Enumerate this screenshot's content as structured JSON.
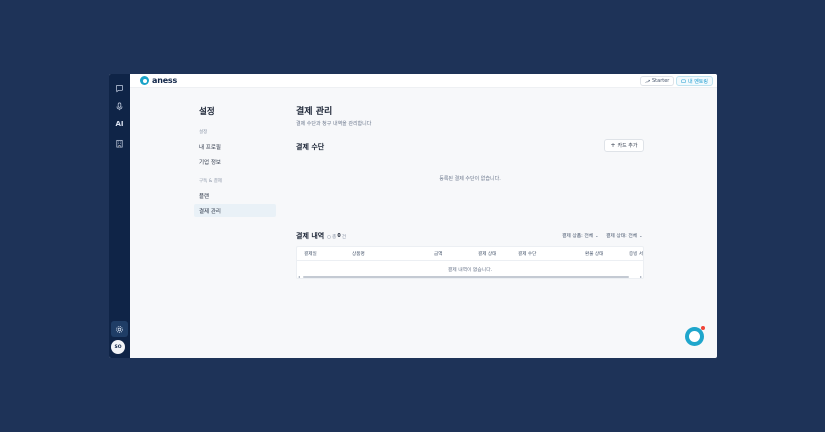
{
  "app": {
    "logo_text": "aness"
  },
  "rail": {
    "ai_label": "AI",
    "avatar_initials": "SO"
  },
  "topbar": {
    "plan_label": "Starter",
    "link_label": "내 멘토링"
  },
  "sidebar": {
    "title": "설정",
    "section1": "설정",
    "items1": [
      "내 프로필",
      "기업 정보"
    ],
    "section2": "구독 & 결제",
    "items2": [
      "플랜",
      "결제 관리"
    ]
  },
  "main": {
    "title": "결제 관리",
    "subtitle": "결제 수단과 청구 내역을 관리합니다",
    "payment_method_heading": "결제 수단",
    "add_card_label": "카드 추가",
    "payment_method_empty": "등록된 결제 수단이 없습니다.",
    "history_heading": "결제 내역",
    "count_prefix": "총",
    "count_value": "0",
    "count_suffix": "건",
    "filter_product": "결제 상품: 전체",
    "filter_status": "결제 상태: 전체",
    "columns": [
      "결제일",
      "상품명",
      "금액",
      "결제 상태",
      "결제 수단",
      "환불 상태",
      "증빙 서"
    ],
    "history_empty": "결제 내역이 없습니다."
  },
  "colors": {
    "background": "#1e3358",
    "rail": "#0f2447",
    "accent": "#1fa6cc"
  }
}
